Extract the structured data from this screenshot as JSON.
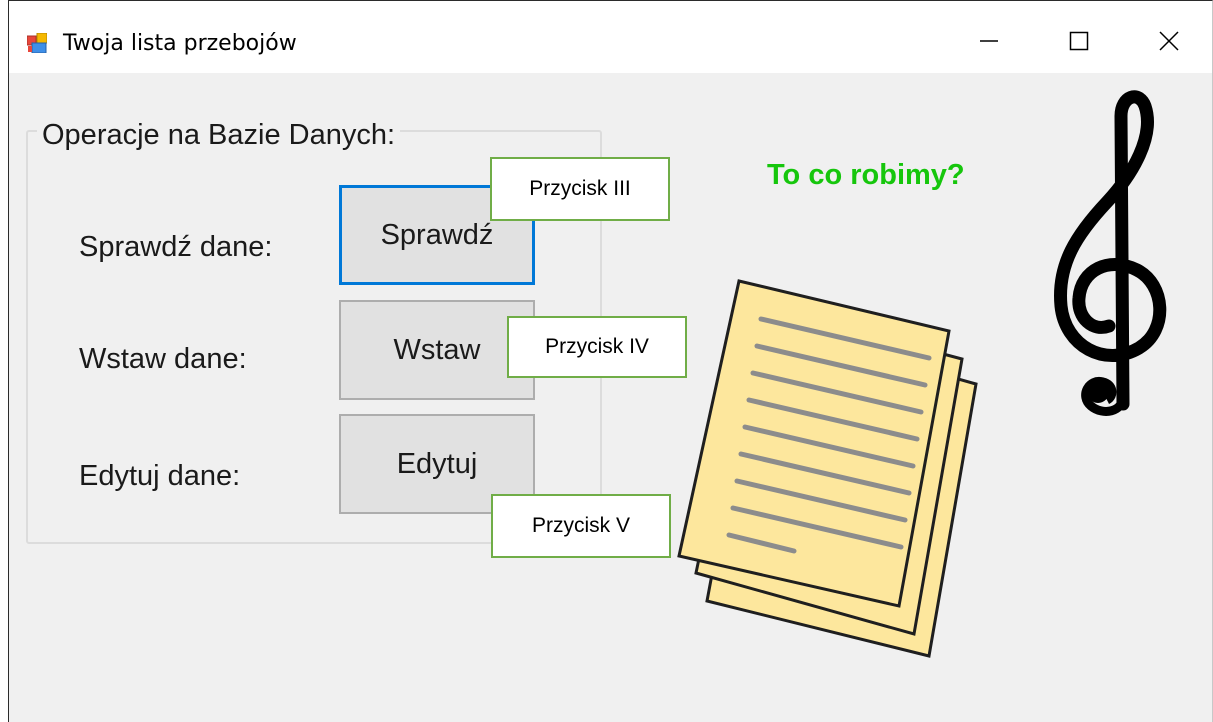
{
  "window": {
    "title": "Twoja lista przebojów",
    "app_icon": "winforms-app-icon",
    "caption_buttons": [
      "minimize-icon",
      "maximize-icon",
      "close-icon"
    ]
  },
  "groupbox": {
    "legend": "Operacje na Bazie Danych:",
    "rows": [
      {
        "label": "Sprawdź dane:",
        "button": "Sprawdź",
        "focused": true
      },
      {
        "label": "Wstaw dane:",
        "button": "Wstaw",
        "focused": false
      },
      {
        "label": "Edytuj dane:",
        "button": "Edytuj",
        "focused": false
      }
    ]
  },
  "callouts": [
    "Przycisk III",
    "Przycisk IV",
    "Przycisk V"
  ],
  "question": "To co robimy?",
  "images": [
    "document-stack-icon",
    "treble-clef-icon"
  ],
  "colors": {
    "focus_border": "#0078d7",
    "callout_border": "#70ad47",
    "question_text": "#16c60c",
    "paper_fill": "#fde79d"
  }
}
